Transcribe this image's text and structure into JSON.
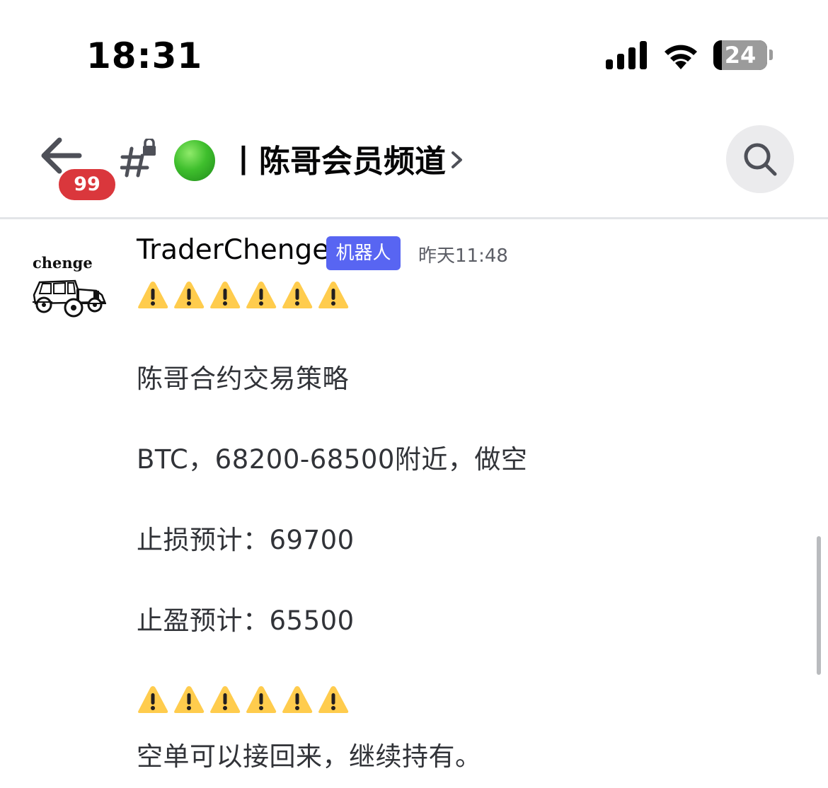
{
  "status_bar": {
    "time": "18:31",
    "battery_level": "24",
    "icons": [
      "signal-icon",
      "wifi-icon",
      "battery-icon"
    ]
  },
  "header": {
    "back_icon": "back-arrow-icon",
    "unread_count": "99",
    "channel_icon": "locked-hash-channel-icon",
    "status_emoji": "green-circle",
    "channel_name": "丨陈哥会员频道",
    "chevron_icon": "chevron-right-icon",
    "search_icon": "search-icon"
  },
  "message": {
    "avatar_text": "chenge",
    "author": "TraderChenge",
    "bot_tag": "机器人",
    "timestamp": "昨天11:48",
    "warning_count": 6,
    "lines": [
      "陈哥合约交易策略",
      "BTC，68200-68500附近，做空",
      "止损预计：69700",
      "止盈预计：65500",
      "空单可以接回来，继续持有。"
    ]
  },
  "colors": {
    "bot_tag": "#5865f2",
    "badge": "#da373c",
    "warning": "#ffcc4d",
    "status_dot": "#3fbf2d"
  }
}
